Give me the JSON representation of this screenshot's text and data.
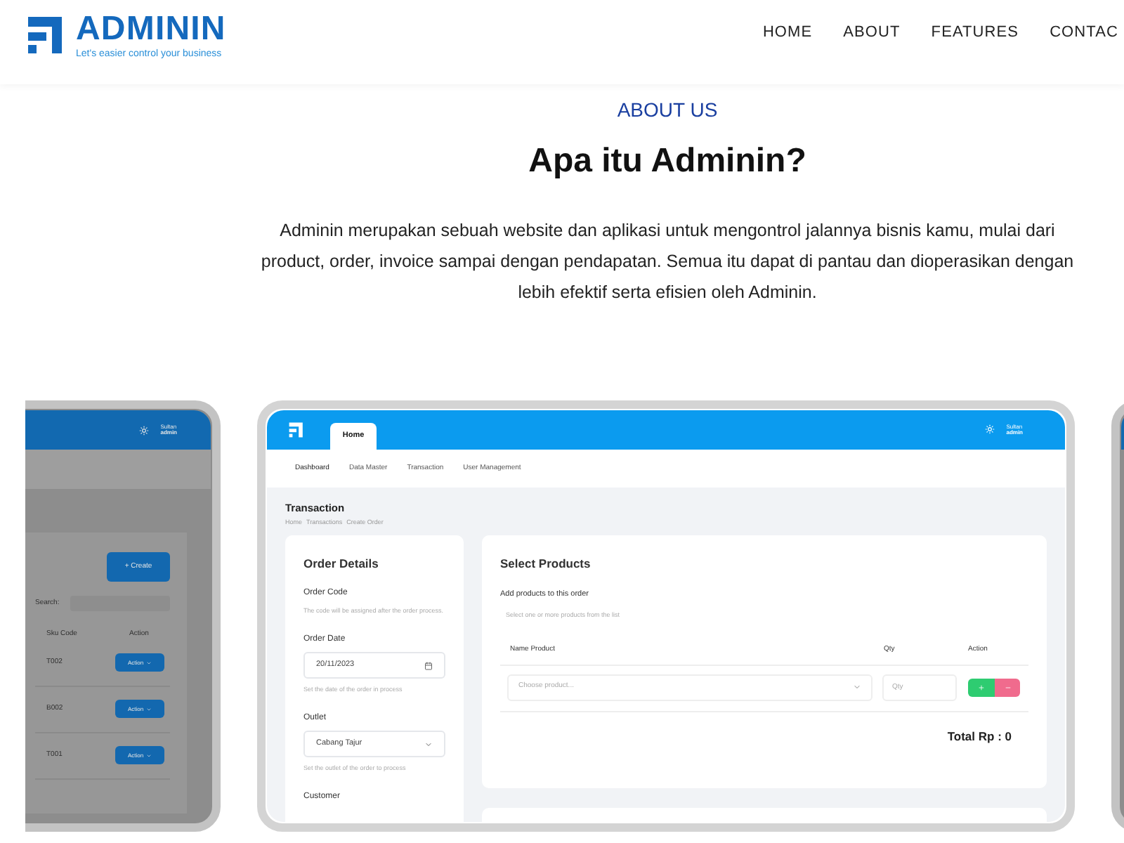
{
  "header": {
    "logo": {
      "name": "ADMININ",
      "tagline": "Let's easier control your business"
    },
    "nav": [
      {
        "label": "HOME"
      },
      {
        "label": "ABOUT"
      },
      {
        "label": "FEATURES"
      },
      {
        "label": "CONTAC"
      }
    ]
  },
  "about": {
    "eyebrow": "ABOUT US",
    "title": "Apa itu Adminin?",
    "description": "Adminin merupakan sebuah website dan aplikasi untuk mengontrol jalannya bisnis kamu, mulai dari product, order, invoice sampai dengan pendapatan. Semua itu dapat di pantau dan dioperasikan dengan lebih efektif serta efisien oleh Adminin."
  },
  "slides": [
    {
      "kind": "list",
      "selected": false,
      "user": {
        "name": "Sultan",
        "role": "admin"
      },
      "create_button": "+ Create",
      "search_label": "Search:",
      "columns": [
        "Sku Code",
        "Action"
      ],
      "rows": [
        {
          "sku": "T002",
          "action": "Action"
        },
        {
          "sku": "B002",
          "action": "Action"
        },
        {
          "sku": "T001",
          "action": "Action"
        }
      ]
    },
    {
      "kind": "form",
      "selected": true,
      "user": {
        "name": "Sultan",
        "role": "admin"
      },
      "tabs": [
        {
          "label": "Home",
          "selected": true
        }
      ],
      "menu": [
        "Dashboard",
        "Data Master",
        "Transaction",
        "User Management"
      ],
      "page_title": "Transaction",
      "breadcrumb": [
        "Home",
        "Transactions",
        "Create Order"
      ],
      "order_details": {
        "title": "Order Details",
        "fields": [
          {
            "kind": "text",
            "label": "Order Code",
            "help": "The code will be assigned after the order process."
          },
          {
            "kind": "date",
            "label": "Order Date",
            "value": "20/11/2023",
            "help": "Set the date of the order in process"
          },
          {
            "kind": "select",
            "label": "Outlet",
            "value": "Cabang Tajur",
            "help": "Set the outlet of the order to process"
          },
          {
            "kind": "label",
            "label": "Customer"
          }
        ]
      },
      "select_products": {
        "title": "Select Products",
        "subtitle": "Add products to this order",
        "hint": "Select one or more products from the list",
        "columns": [
          "Name Product",
          "Qty",
          "Action"
        ],
        "product_placeholder": "Choose product...",
        "qty_placeholder": "Qty",
        "total": "Total Rp : 0"
      }
    },
    {
      "kind": "blank",
      "selected": false
    }
  ]
}
